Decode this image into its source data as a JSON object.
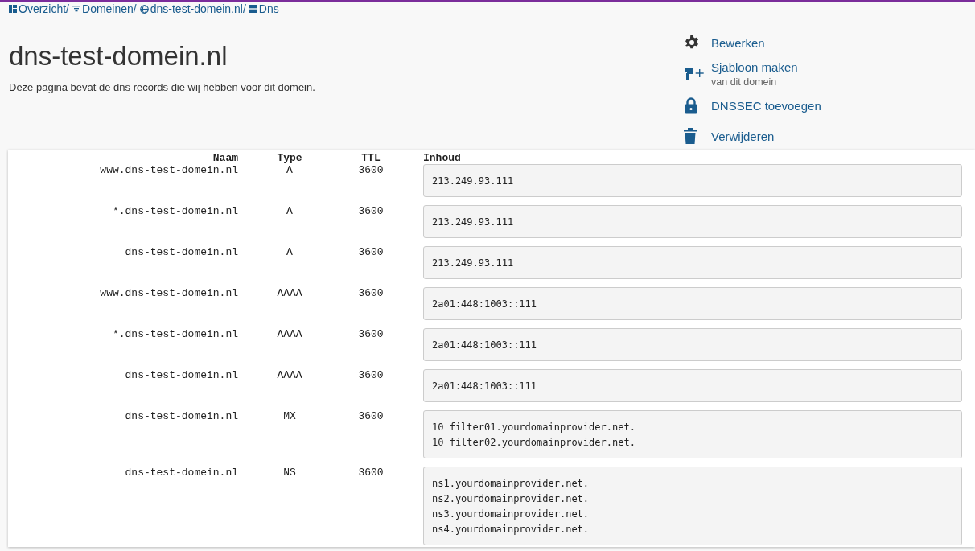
{
  "breadcrumb": [
    {
      "label": "Overzicht/"
    },
    {
      "label": "Domeinen/"
    },
    {
      "label": "dns-test-domein.nl/"
    },
    {
      "label": "Dns"
    }
  ],
  "title": "dns-test-domein.nl",
  "description": "Deze pagina bevat de dns records die wij hebben voor dit domein.",
  "actions": [
    {
      "label": "Bewerken"
    },
    {
      "label": "Sjabloon maken",
      "sublabel": "van dit domein"
    },
    {
      "label": "DNSSEC toevoegen"
    },
    {
      "label": "Verwijderen"
    }
  ],
  "table": {
    "columns": [
      "Naam",
      "Type",
      "TTL",
      "Inhoud"
    ],
    "rows": [
      {
        "name": "www.dns-test-domein.nl",
        "type": "A",
        "ttl": "3600",
        "content": [
          "213.249.93.111"
        ]
      },
      {
        "name": "*.dns-test-domein.nl",
        "type": "A",
        "ttl": "3600",
        "content": [
          "213.249.93.111"
        ]
      },
      {
        "name": "dns-test-domein.nl",
        "type": "A",
        "ttl": "3600",
        "content": [
          "213.249.93.111"
        ]
      },
      {
        "name": "www.dns-test-domein.nl",
        "type": "AAAA",
        "ttl": "3600",
        "content": [
          "2a01:448:1003::111"
        ]
      },
      {
        "name": "*.dns-test-domein.nl",
        "type": "AAAA",
        "ttl": "3600",
        "content": [
          "2a01:448:1003::111"
        ]
      },
      {
        "name": "dns-test-domein.nl",
        "type": "AAAA",
        "ttl": "3600",
        "content": [
          "2a01:448:1003::111"
        ]
      },
      {
        "name": "dns-test-domein.nl",
        "type": "MX",
        "ttl": "3600",
        "content": [
          "10 filter01.yourdomainprovider.net.",
          "10 filter02.yourdomainprovider.net."
        ]
      },
      {
        "name": "dns-test-domein.nl",
        "type": "NS",
        "ttl": "3600",
        "content": [
          "ns1.yourdomainprovider.net.",
          "ns2.yourdomainprovider.net.",
          "ns3.yourdomainprovider.net.",
          "ns4.yourdomainprovider.net."
        ]
      }
    ]
  }
}
